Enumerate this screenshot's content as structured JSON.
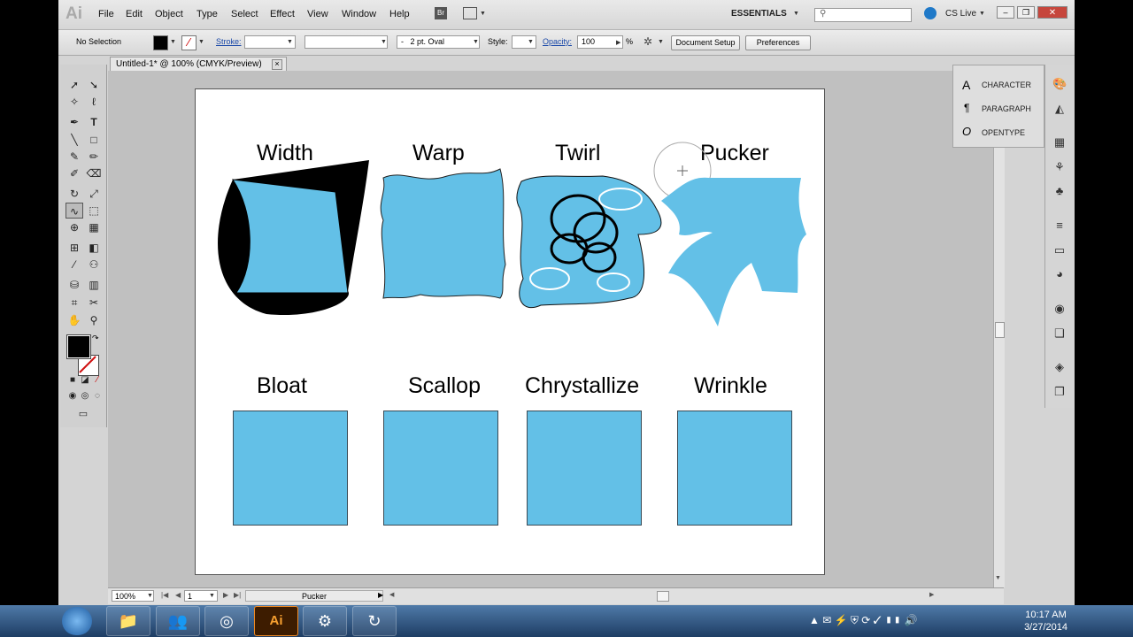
{
  "app": {
    "logo": "Ai",
    "menus": [
      "File",
      "Edit",
      "Object",
      "Type",
      "Select",
      "Effect",
      "View",
      "Window",
      "Help"
    ],
    "bridge_label": "Br",
    "workspace": "ESSENTIALS",
    "cs_live": "CS Live"
  },
  "control": {
    "selection": "No Selection",
    "stroke_label": "Stroke:",
    "brush": "2 pt. Oval",
    "brush_prefix": "-",
    "style_label": "Style:",
    "opacity_label": "Opacity:",
    "opacity_value": "100",
    "opacity_unit": "%",
    "document_setup": "Document Setup",
    "preferences": "Preferences"
  },
  "document": {
    "tab_title": "Untitled-1* @ 100% (CMYK/Preview)",
    "close_glyph": "×"
  },
  "artboard": {
    "top_labels": [
      "Width",
      "Warp",
      "Twirl",
      "Pucker"
    ],
    "bottom_labels": [
      "Bloat",
      "Scallop",
      "Chrystallize",
      "Wrinkle"
    ],
    "fill_color": "#63c0e7"
  },
  "status": {
    "zoom": "100%",
    "artboard_number": "1",
    "current_tool": "Pucker"
  },
  "panels": {
    "items": [
      {
        "icon": "A",
        "label": "CHARACTER"
      },
      {
        "icon": "¶",
        "label": "PARAGRAPH"
      },
      {
        "icon": "O",
        "label": "OPENTYPE"
      }
    ]
  },
  "taskbar": {
    "time": "10:17 AM",
    "date": "3/27/2014",
    "illustrator_label": "Ai"
  }
}
